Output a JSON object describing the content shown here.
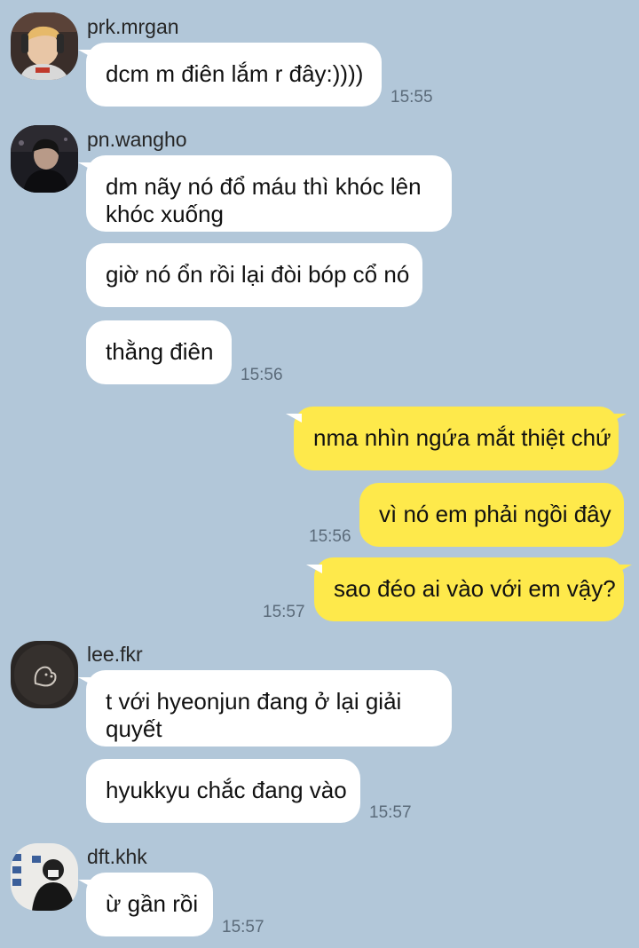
{
  "messages": [
    {
      "sender": "prk.mrgan",
      "text": "dcm m điên lắm r đây:))))",
      "time": "15:55"
    },
    {
      "sender": "pn.wangho",
      "text_lines": [
        "dm nãy nó đổ máu thì khóc lên",
        "khóc xuống"
      ]
    },
    {
      "text": "giờ nó ổn rồi lại đòi bóp cổ nó"
    },
    {
      "text": "thằng điên",
      "time": "15:56"
    },
    {
      "outgoing": true,
      "text": "nma nhìn ngứa mắt thiệt chứ"
    },
    {
      "outgoing": true,
      "text": "vì nó em phải ngồi đây",
      "time": "15:56"
    },
    {
      "outgoing": true,
      "text": "sao đéo ai vào với em vậy?",
      "time": "15:57"
    },
    {
      "sender": "lee.fkr",
      "text_lines": [
        "t với hyeonjun đang ở lại giải",
        "quyết"
      ]
    },
    {
      "text": "hyukkyu chắc đang vào",
      "time": "15:57"
    },
    {
      "sender": "dft.khk",
      "text": "ừ gần rồi",
      "time": "15:57"
    }
  ],
  "colors": {
    "background": "#b2c7d9",
    "incoming_bubble": "#ffffff",
    "outgoing_bubble": "#fee94b",
    "timestamp": "#5b6b7a"
  },
  "icons": [
    "avatar-prk-mrgan",
    "avatar-pn-wangho",
    "avatar-lee-fkr",
    "avatar-dft-khk"
  ]
}
